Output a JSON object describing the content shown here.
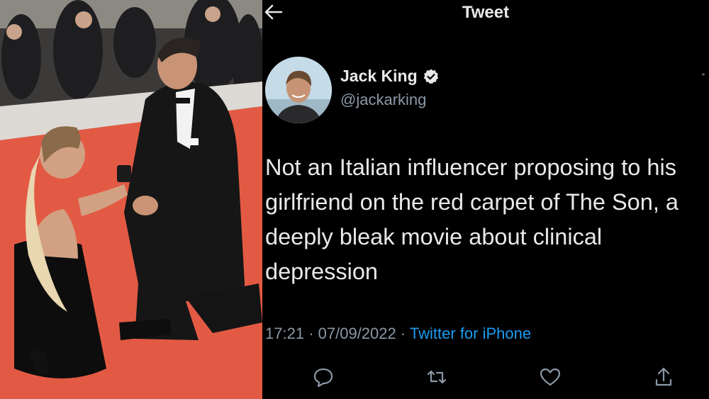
{
  "header": {
    "title": "Tweet"
  },
  "author": {
    "name": "Jack King",
    "handle": "@jackarking"
  },
  "tweet": {
    "text": "Not an Italian influencer proposing to his girlfriend on the red carpet of The Son, a deeply bleak movie about clinical depression",
    "time": "17:21",
    "date": "07/09/2022",
    "source": "Twitter for iPhone"
  },
  "icons": {
    "back": "arrow-left-icon",
    "verified": "verified-badge-icon",
    "reply": "reply-icon",
    "retweet": "retweet-icon",
    "like": "like-icon",
    "share": "share-icon"
  },
  "colors": {
    "link": "#1d9bf0",
    "verified": "#e7e9ea",
    "background": "#000000",
    "carpet": "#e35a44"
  }
}
